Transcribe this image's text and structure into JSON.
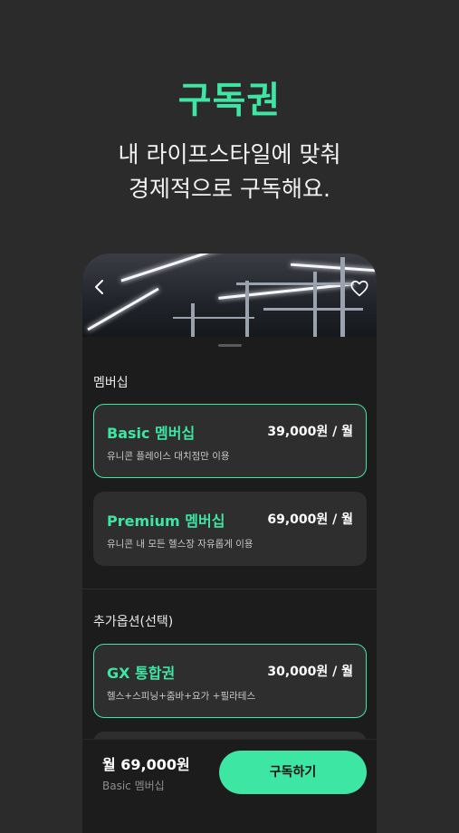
{
  "hero": {
    "title": "구독권",
    "subtitle_line1": "내 라이프스타일에 맞춰",
    "subtitle_line2": "경제적으로 구독해요."
  },
  "header": {
    "back_icon": "chevron-left-icon",
    "favorite_icon": "heart-icon"
  },
  "membership": {
    "section_label": "멤버십",
    "plans": [
      {
        "name": "Basic 멤버십",
        "price": "39,000원 / 월",
        "desc": "유니콘 플레이스 대치점만 이용",
        "selected": true
      },
      {
        "name": "Premium 멤버십",
        "price": "69,000원 / 월",
        "desc": "유니콘 내 모든 헬스장 자유롭게 이용",
        "selected": false
      }
    ]
  },
  "options": {
    "section_label": "추가옵션(선택)",
    "items": [
      {
        "name": "GX 통합권",
        "price": "30,000원 / 월",
        "desc": "헬스+스피닝+줌바+요가 +필라테스",
        "selected": true
      }
    ]
  },
  "footer": {
    "total_price": "월 69,000원",
    "plan_name": "Basic 멤버십",
    "subscribe_label": "구독하기"
  },
  "colors": {
    "accent": "#3ee6a3",
    "background": "#2b2b2b",
    "panel": "#1c1c1c",
    "card": "#2e2e2e"
  }
}
